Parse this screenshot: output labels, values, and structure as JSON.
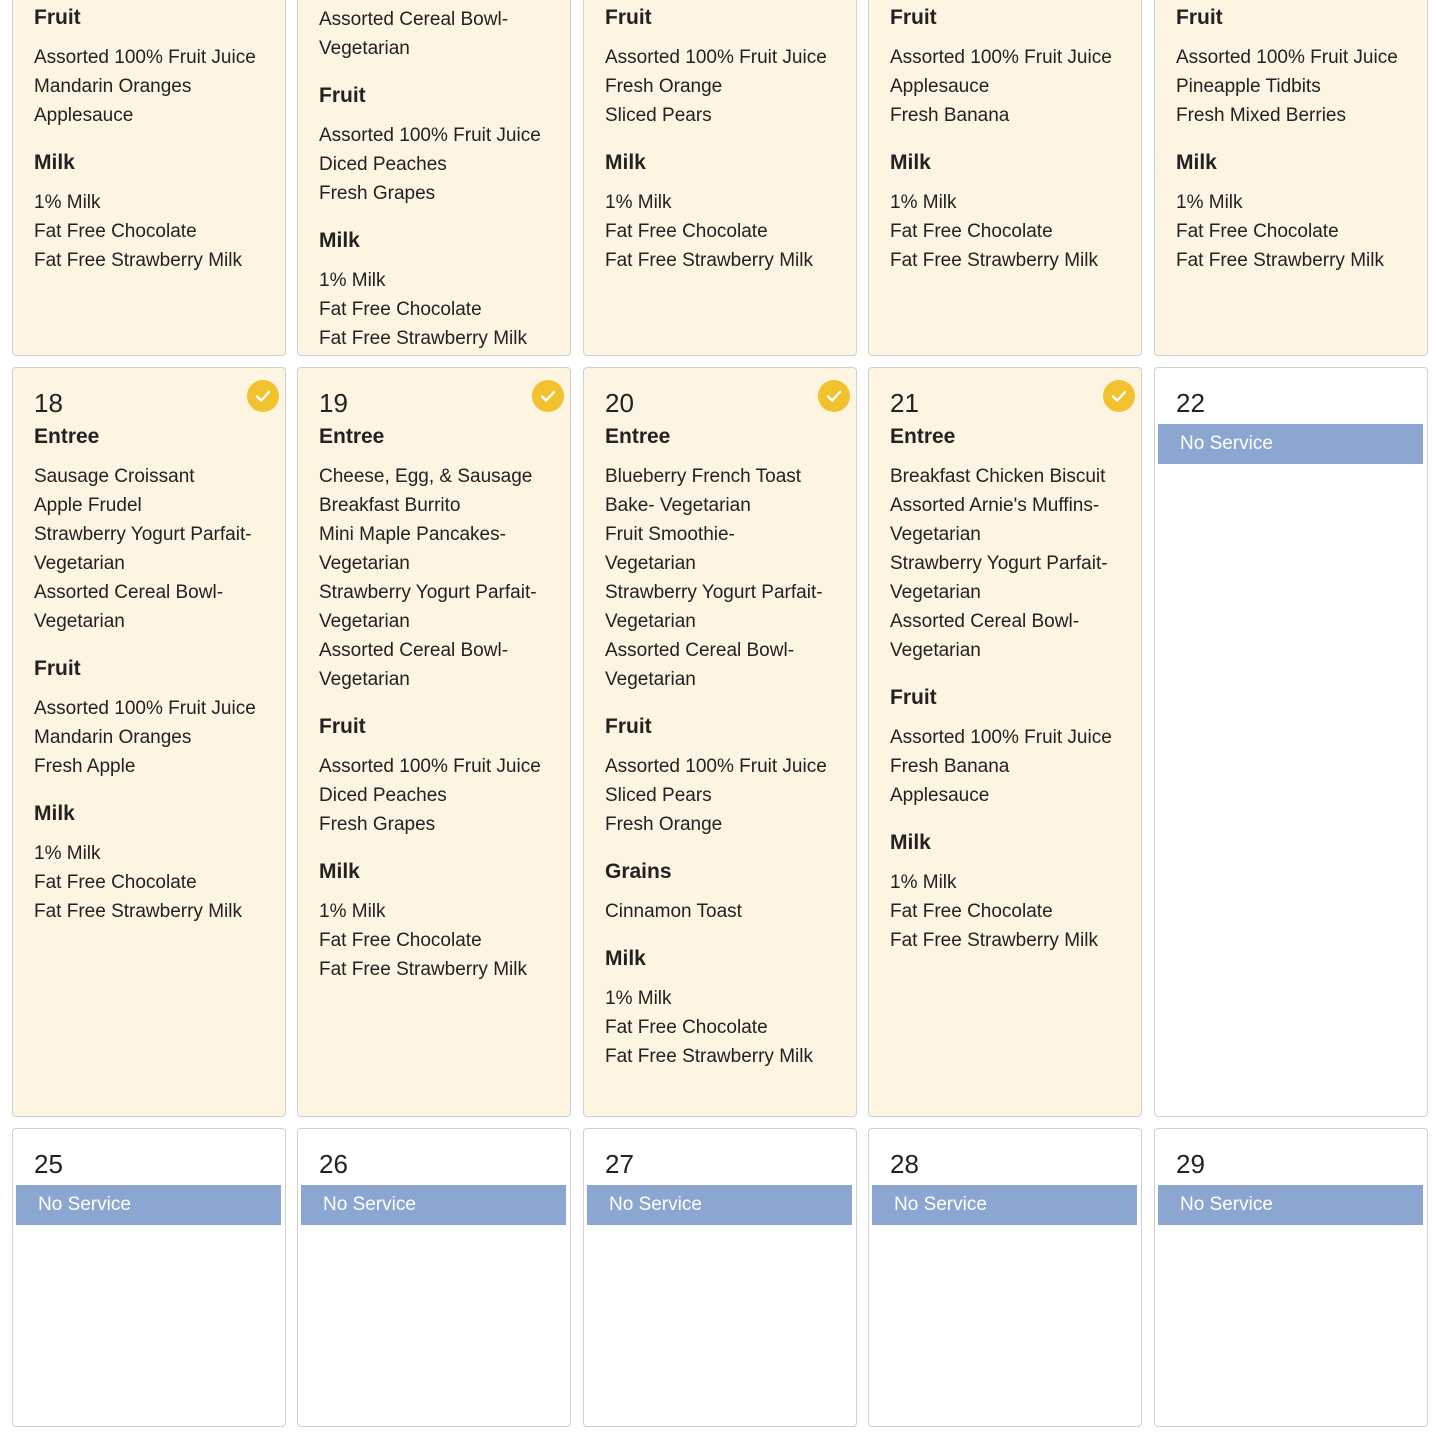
{
  "rows": [
    {
      "days": [
        {
          "groups": [
            {
              "category": "Fruit",
              "items": [
                "Assorted 100% Fruit Juice",
                "Mandarin Oranges",
                "Applesauce"
              ]
            },
            {
              "category": "Milk",
              "items": [
                "1% Milk",
                "Fat Free Chocolate",
                "Fat Free Strawberry Milk"
              ]
            }
          ]
        },
        {
          "groups": [
            {
              "category": "",
              "items": [
                "Assorted Cereal Bowl-",
                "Vegetarian"
              ]
            },
            {
              "category": "Fruit",
              "items": [
                "Assorted 100% Fruit Juice",
                "Diced Peaches",
                "Fresh Grapes"
              ]
            },
            {
              "category": "Milk",
              "items": [
                "1% Milk",
                "Fat Free Chocolate",
                "Fat Free Strawberry Milk"
              ]
            }
          ]
        },
        {
          "groups": [
            {
              "category": "Fruit",
              "items": [
                "Assorted 100% Fruit Juice",
                "Fresh Orange",
                "Sliced Pears"
              ]
            },
            {
              "category": "Milk",
              "items": [
                "1% Milk",
                "Fat Free Chocolate",
                "Fat Free Strawberry Milk"
              ]
            }
          ]
        },
        {
          "groups": [
            {
              "category": "Fruit",
              "items": [
                "Assorted 100% Fruit Juice",
                "Applesauce",
                "Fresh Banana"
              ]
            },
            {
              "category": "Milk",
              "items": [
                "1% Milk",
                "Fat Free Chocolate",
                "Fat Free Strawberry Milk"
              ]
            }
          ]
        },
        {
          "groups": [
            {
              "category": "Fruit",
              "items": [
                "Assorted 100% Fruit Juice",
                "Pineapple Tidbits",
                "Fresh Mixed Berries"
              ]
            },
            {
              "category": "Milk",
              "items": [
                "1% Milk",
                "Fat Free Chocolate",
                "Fat Free Strawberry Milk"
              ]
            }
          ]
        }
      ]
    },
    {
      "days": [
        {
          "day": "18",
          "checked": true,
          "groups": [
            {
              "category": "Entree",
              "items": [
                "Sausage Croissant",
                "Apple Frudel",
                "Strawberry Yogurt Parfait-",
                "Vegetarian",
                "Assorted Cereal Bowl-",
                "Vegetarian"
              ]
            },
            {
              "category": "Fruit",
              "items": [
                "Assorted 100% Fruit Juice",
                "Mandarin Oranges",
                "Fresh Apple"
              ]
            },
            {
              "category": "Milk",
              "items": [
                "1% Milk",
                "Fat Free Chocolate",
                "Fat Free Strawberry Milk"
              ]
            }
          ]
        },
        {
          "day": "19",
          "checked": true,
          "groups": [
            {
              "category": "Entree",
              "items": [
                "Cheese, Egg, & Sausage",
                "Breakfast Burrito",
                "Mini Maple Pancakes-",
                "Vegetarian",
                "Strawberry Yogurt Parfait-",
                "Vegetarian",
                "Assorted Cereal Bowl-",
                "Vegetarian"
              ]
            },
            {
              "category": "Fruit",
              "items": [
                "Assorted 100% Fruit Juice",
                "Diced Peaches",
                "Fresh Grapes"
              ]
            },
            {
              "category": "Milk",
              "items": [
                "1% Milk",
                "Fat Free Chocolate",
                "Fat Free Strawberry Milk"
              ]
            }
          ]
        },
        {
          "day": "20",
          "checked": true,
          "groups": [
            {
              "category": "Entree",
              "items": [
                "Blueberry French Toast",
                "Bake- Vegetarian",
                "Fruit Smoothie-",
                "Vegetarian",
                "Strawberry Yogurt Parfait-",
                "Vegetarian",
                "Assorted Cereal Bowl-",
                "Vegetarian"
              ]
            },
            {
              "category": "Fruit",
              "items": [
                "Assorted 100% Fruit Juice",
                "Sliced Pears",
                "Fresh Orange"
              ]
            },
            {
              "category": "Grains",
              "items": [
                "Cinnamon Toast"
              ]
            },
            {
              "category": "Milk",
              "items": [
                "1% Milk",
                "Fat Free Chocolate",
                "Fat Free Strawberry Milk"
              ]
            }
          ]
        },
        {
          "day": "21",
          "checked": true,
          "groups": [
            {
              "category": "Entree",
              "items": [
                "Breakfast Chicken Biscuit",
                "Assorted Arnie's Muffins-",
                "Vegetarian",
                "Strawberry Yogurt Parfait-",
                "Vegetarian",
                "Assorted Cereal Bowl-",
                "Vegetarian"
              ]
            },
            {
              "category": "Fruit",
              "items": [
                "Assorted 100% Fruit Juice",
                "Fresh Banana",
                "Applesauce"
              ]
            },
            {
              "category": "Milk",
              "items": [
                "1% Milk",
                "Fat Free Chocolate",
                "Fat Free Strawberry Milk"
              ]
            }
          ]
        },
        {
          "day": "22",
          "no_service": "No Service"
        }
      ]
    },
    {
      "days": [
        {
          "day": "25",
          "no_service": "No Service"
        },
        {
          "day": "26",
          "no_service": "No Service"
        },
        {
          "day": "27",
          "no_service": "No Service"
        },
        {
          "day": "28",
          "no_service": "No Service"
        },
        {
          "day": "29",
          "no_service": "No Service"
        }
      ]
    }
  ],
  "colors": {
    "menu_bg": "#fdf4e1",
    "check": "#f2c12e",
    "no_service_bg": "#8ba7d1",
    "border": "#cfcfd4"
  }
}
